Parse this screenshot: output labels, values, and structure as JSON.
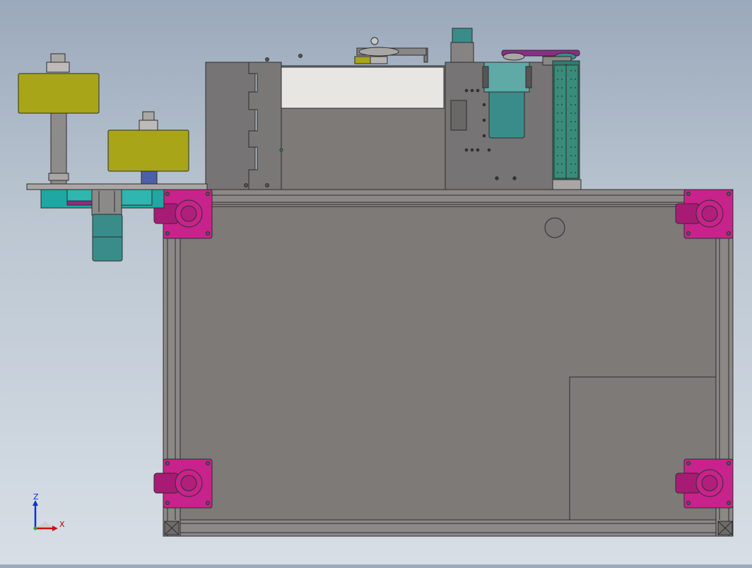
{
  "viewport": {
    "colors": {
      "frame": "#7d7a78",
      "frame_edge": "#3a3a3a",
      "caster": "#c8228c",
      "motor": "#3a8c8a",
      "roller": "#a8a518",
      "panel_light": "#e8e6e3",
      "teal_block": "#1fa7a3",
      "purple_belt": "#8a2d86"
    }
  },
  "triad": {
    "x_label": "X",
    "z_label": "Z",
    "colors": {
      "x": "#d01010",
      "z": "#1030d0",
      "y": "#30a030"
    }
  }
}
